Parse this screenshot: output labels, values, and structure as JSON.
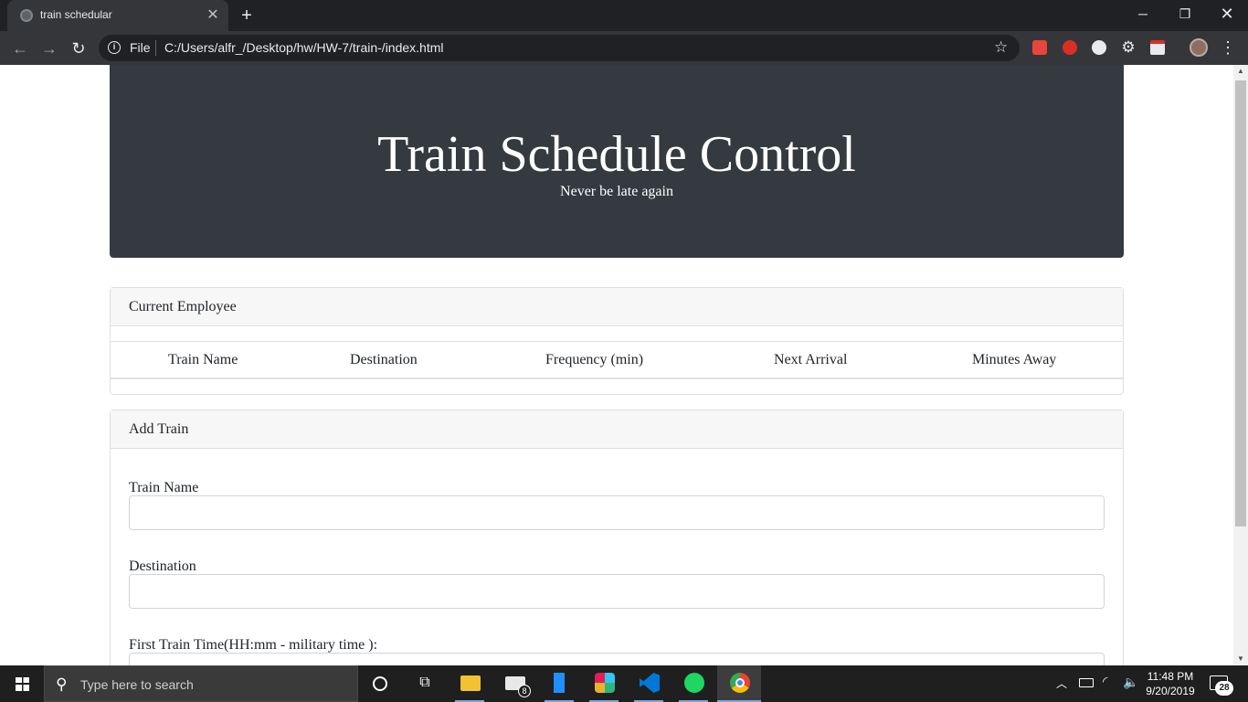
{
  "browser": {
    "tab_title": "train schedular",
    "close_glyph": "✕",
    "newtab_glyph": "+",
    "scheme_label": "File",
    "url": "C:/Users/alfr_/Desktop/hw/HW-7/train-/index.html",
    "window": {
      "minimize": "─",
      "maximize": "❐",
      "close": "✕"
    },
    "nav": {
      "back": "←",
      "forward": "→",
      "reload": "↻",
      "info": "i",
      "star": "☆",
      "menu": "⋮"
    },
    "extensions": [
      "pushbullet-icon",
      "adblock-icon",
      "extension-icon",
      "settings-icon",
      "note-icon"
    ]
  },
  "page": {
    "title": "Train Schedule Control",
    "subtitle": "Never be late again",
    "current_card": {
      "header": "Current Employee",
      "columns": [
        "Train Name",
        "Destination",
        "Frequency (min)",
        "Next Arrival",
        "Minutes Away"
      ]
    },
    "add_card": {
      "header": "Add Train",
      "fields": [
        {
          "label": "Train Name",
          "value": ""
        },
        {
          "label": "Destination",
          "value": ""
        },
        {
          "label": "First Train Time(HH:mm - military time ):",
          "value": ""
        }
      ]
    }
  },
  "taskbar": {
    "search_placeholder": "Type here to search",
    "mail_badge": "8",
    "time": "11:48 PM",
    "date": "9/20/2019",
    "notification_count": "28",
    "apps": [
      "cortana",
      "task-view",
      "file-explorer",
      "mail",
      "phone",
      "slack",
      "vscode",
      "spotify",
      "chrome"
    ],
    "glyphs": {
      "search": "⚲",
      "taskview": "⧉",
      "chevron": "︿",
      "wifi": "◜",
      "volume": "🔈"
    }
  },
  "colors": {
    "jumbotron_bg": "#343a40",
    "browser_frame": "#202124",
    "toolbar": "#35363a",
    "taskbar": "#1f1f1f"
  }
}
